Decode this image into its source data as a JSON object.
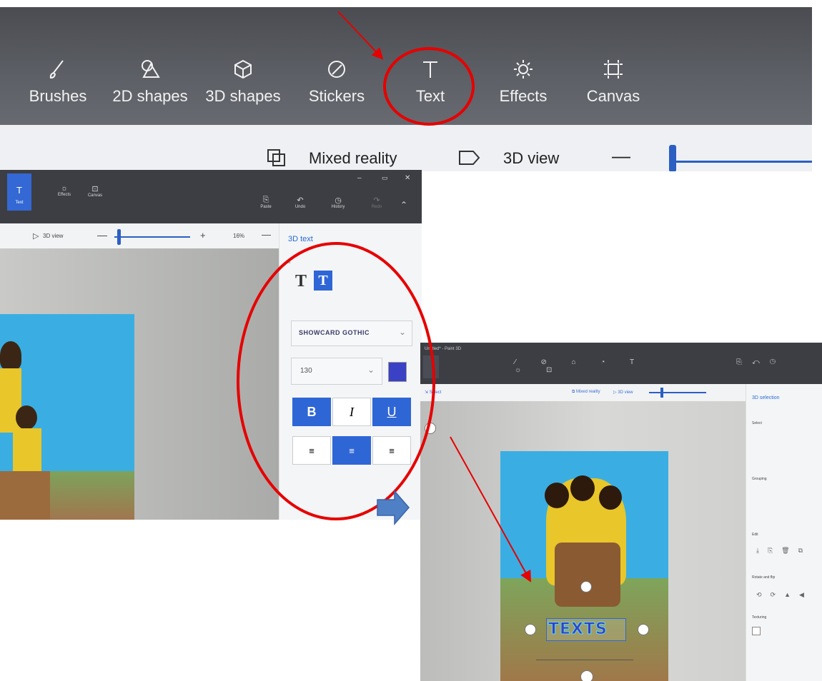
{
  "toolbar": {
    "tools": [
      {
        "label": "Brushes",
        "icon": "brush-icon"
      },
      {
        "label": "2D shapes",
        "icon": "2d-shapes-icon"
      },
      {
        "label": "3D shapes",
        "icon": "3d-shapes-icon"
      },
      {
        "label": "Stickers",
        "icon": "stickers-icon"
      },
      {
        "label": "Text",
        "icon": "text-icon"
      },
      {
        "label": "Effects",
        "icon": "effects-icon"
      },
      {
        "label": "Canvas",
        "icon": "canvas-icon"
      }
    ],
    "mixed_reality_label": "Mixed reality",
    "view_3d_label": "3D view",
    "zoom_minus": "—"
  },
  "text_panel": {
    "ribbon": {
      "text": "Text",
      "effects": "Effects",
      "canvas": "Canvas",
      "paste": "Paste",
      "undo": "Undo",
      "history": "History",
      "redo": "Redo"
    },
    "view_label": "3D view",
    "zoom_percent": "16%",
    "zoom_plus": "+",
    "title": "3D text",
    "type_label": "Text",
    "font_name": "SHOWCARD GOTHIC",
    "font_size": "130",
    "text_color": "#3b41c5",
    "bold": "B",
    "italic": "I",
    "underline": "U"
  },
  "result_panel": {
    "window_title": "Untitled* - Paint 3D",
    "side_title": "3D selection",
    "sections": [
      "Select",
      "Grouping",
      "Edit",
      "Rotate and flip",
      "Texturing"
    ],
    "canvas_text": "TEXTS"
  },
  "colors": {
    "annotation_red": "#e60000",
    "accent_blue": "#3366cc",
    "arrow_blue": "#4f7fc4"
  }
}
